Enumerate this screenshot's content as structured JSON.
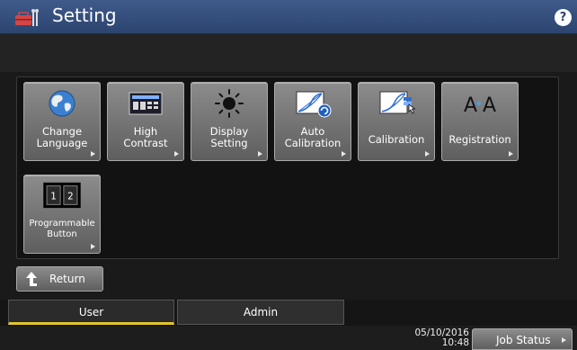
{
  "header": {
    "title": "Setting",
    "help_label": "?",
    "icon": "settings-toolbox-icon"
  },
  "tiles": [
    {
      "label": "Change\nLanguage",
      "icon": "globe-icon"
    },
    {
      "label": "High\nContrast",
      "icon": "high-contrast-icon"
    },
    {
      "label": "Display\nSetting",
      "icon": "brightness-sun-icon"
    },
    {
      "label": "Auto\nCalibration",
      "icon": "auto-calibration-icon"
    },
    {
      "label": "Calibration",
      "icon": "calibration-icon"
    },
    {
      "label": "Registration",
      "icon": "registration-icon"
    },
    {
      "label": "Programmable\nButton",
      "icon": "programmable-button-icon",
      "keys": [
        "1",
        "2"
      ]
    }
  ],
  "registration_glyphs": [
    "A",
    "A"
  ],
  "return_label": "Return",
  "tabs": [
    {
      "label": "User",
      "active": true
    },
    {
      "label": "Admin",
      "active": false
    }
  ],
  "status": {
    "date": "05/10/2016",
    "time": "10:48",
    "job_status_label": "Job Status"
  },
  "colors": {
    "title_bar": "#2c446f",
    "active_tab_indicator": "#e3c52a",
    "tile": "#7a7a7a"
  }
}
